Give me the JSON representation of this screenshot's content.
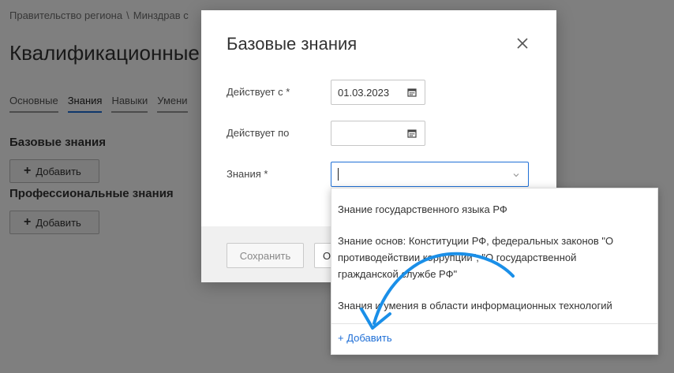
{
  "breadcrumb": {
    "item1": "Правительство региона",
    "separator": "\\",
    "item2": "Минздрав с"
  },
  "page": {
    "title": "Квалификационные"
  },
  "tabs": [
    {
      "label": "Основные"
    },
    {
      "label": "Знания"
    },
    {
      "label": "Навыки"
    },
    {
      "label": "Умени"
    }
  ],
  "sections": {
    "basic_title": "Базовые знания",
    "basic_add": "Добавить",
    "professional_title": "Профессиональные знания",
    "professional_add": "Добавить",
    "plus_icon": "plus-icon"
  },
  "modal": {
    "title": "Базовые знания",
    "close_icon": "close-icon",
    "valid_from_label": "Действует с *",
    "valid_from_value": "01.03.2023",
    "valid_to_label": "Действует по",
    "valid_to_value": "",
    "knowledge_label": "Знания *",
    "knowledge_value": "",
    "calendar_icon": "calendar-icon",
    "chevron_icon": "chevron-down-icon",
    "save_label": "Сохранить",
    "cancel_label": "О"
  },
  "dropdown": {
    "options": [
      "Знание государственного языка РФ",
      "Знание основ: Конституции РФ, федеральных законов \"О противодействии коррупции\", \"О государственной гражданской службе РФ\"",
      "Знания и умения в области информационных технологий"
    ],
    "add_label": "+ Добавить"
  },
  "colors": {
    "accent": "#1f6fd6",
    "overlay": "rgba(0,0,0,0.5)",
    "annotation_arrow": "#1a8fe8"
  }
}
